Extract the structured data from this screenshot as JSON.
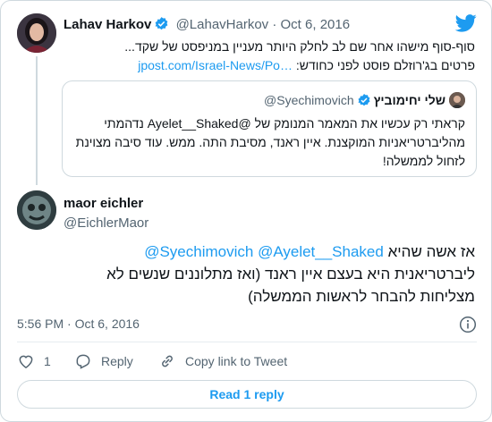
{
  "parent_tweet": {
    "author_name": "Lahav Harkov",
    "handle": "@LahavHarkov",
    "separator": "·",
    "date": "Oct 6, 2016",
    "text": "סוף-סוף מישהו אחר שם לב לחלק היותר מעניין במניפסט של שקד...",
    "text_line2": "פרטים בג'רוזלם פוסט לפני כחודש:",
    "link": "jpost.com/Israel-News/Po…"
  },
  "quoted_tweet": {
    "author_name": "שלי יחימוביץ",
    "handle": "@Syechimovich",
    "line1": "קראתי רק עכשיו את המאמר המנומק של @Ayelet__Shaked נדהמתי",
    "line2": "מהליברטריאניות המוקצנת. איין ראנד, מסיבת התה. ממש. עוד סיבה מצוינת",
    "line3": "לזחול לממשלה!"
  },
  "reply_tweet": {
    "author_name": "maor eichler",
    "handle": "@EichlerMaor",
    "mention1": "@Syechimovich",
    "mention2": "@Ayelet__Shaked",
    "line1_text": "אז אשה שהיא",
    "line2": "ליברטריאנית היא בעצם איין ראנד (ואז מתלוננים שנשים לא",
    "line3": "מצליחות להבחר לראשות הממשלה)",
    "time": "5:56 PM",
    "separator": "·",
    "date": "Oct 6, 2016"
  },
  "actions": {
    "like_count": "1",
    "reply_label": "Reply",
    "copy_label": "Copy link to Tweet"
  },
  "read_replies_label": "Read 1 reply",
  "icons": {
    "brand": "twitter-bird-icon",
    "verified": "verified-badge-icon",
    "info": "info-icon",
    "like": "heart-icon",
    "reply": "reply-icon",
    "copy": "link-icon"
  },
  "colors": {
    "accent": "#1d9bf0",
    "muted": "#536471",
    "border": "#cfd9de"
  }
}
